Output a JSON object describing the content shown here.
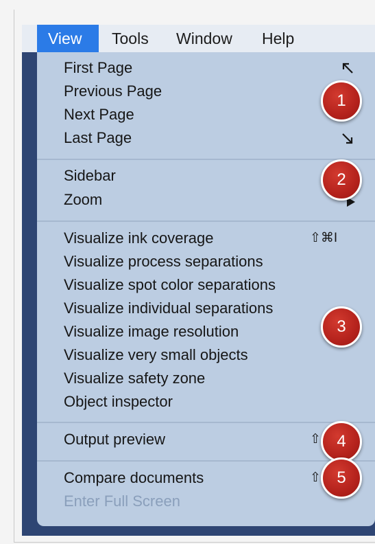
{
  "menubar": {
    "items": [
      {
        "label": "View",
        "active": true
      },
      {
        "label": "Tools"
      },
      {
        "label": "Window"
      },
      {
        "label": "Help"
      }
    ]
  },
  "menu": {
    "items": [
      {
        "label": "First Page",
        "shortcut_icon": "arrow-up-left-icon"
      },
      {
        "label": "Previous Page"
      },
      {
        "label": "Next Page"
      },
      {
        "label": "Last Page",
        "shortcut_icon": "arrow-down-right-icon"
      },
      {
        "label": "Sidebar"
      },
      {
        "label": "Zoom",
        "shortcut_icon": "submenu-arrow-icon"
      },
      {
        "label": "Visualize ink coverage",
        "shortcut": "⇧⌘I"
      },
      {
        "label": "Visualize process separations"
      },
      {
        "label": "Visualize spot color separations"
      },
      {
        "label": "Visualize individual separations"
      },
      {
        "label": "Visualize image resolution"
      },
      {
        "label": "Visualize very small objects"
      },
      {
        "label": "Visualize safety zone"
      },
      {
        "label": "Object inspector"
      },
      {
        "label": "Output preview",
        "shortcut": "⇧⌘"
      },
      {
        "label": "Compare documents",
        "shortcut": "⇧⌘"
      },
      {
        "label": "Enter Full Screen",
        "disabled": true
      }
    ]
  },
  "callouts": [
    "1",
    "2",
    "3",
    "4",
    "5"
  ],
  "colors": {
    "menubar_active": "#2b7be7",
    "menu_background": "#bccde2",
    "callout_red": "#b4221c",
    "disabled_text": "#8a9fbb"
  }
}
